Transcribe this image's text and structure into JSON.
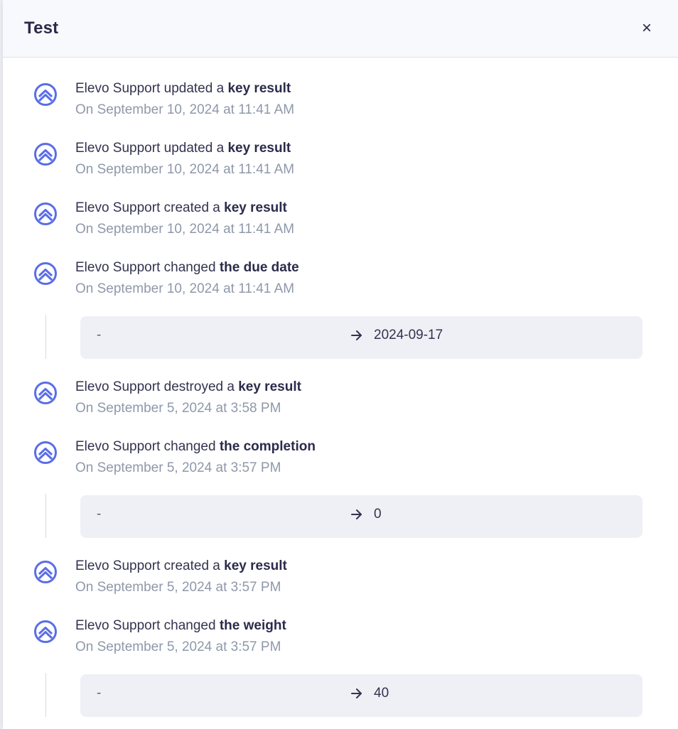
{
  "panel": {
    "title": "Test",
    "close_label": "×"
  },
  "entries": [
    {
      "actor": "Elevo Support",
      "action": " updated a ",
      "target": "key result",
      "timestamp": "On September 10, 2024 at 11:41 AM"
    },
    {
      "actor": "Elevo Support",
      "action": " updated a ",
      "target": "key result",
      "timestamp": "On September 10, 2024 at 11:41 AM"
    },
    {
      "actor": "Elevo Support",
      "action": " created a ",
      "target": "key result",
      "timestamp": "On September 10, 2024 at 11:41 AM"
    },
    {
      "actor": "Elevo Support",
      "action": " changed ",
      "target": "the due date",
      "timestamp": "On September 10, 2024 at 11:41 AM"
    },
    {
      "actor": "Elevo Support",
      "action": " destroyed a ",
      "target": "key result",
      "timestamp": "On September 5, 2024 at 3:58 PM"
    },
    {
      "actor": "Elevo Support",
      "action": " changed ",
      "target": "the completion",
      "timestamp": "On September 5, 2024 at 3:57 PM"
    },
    {
      "actor": "Elevo Support",
      "action": " created a ",
      "target": "key result",
      "timestamp": "On September 5, 2024 at 3:57 PM"
    },
    {
      "actor": "Elevo Support",
      "action": " changed ",
      "target": "the weight",
      "timestamp": "On September 5, 2024 at 3:57 PM"
    }
  ],
  "changes": [
    {
      "old": "-",
      "new": "2024-09-17"
    },
    {
      "old": "-",
      "new": "0"
    },
    {
      "old": "-",
      "new": "40"
    }
  ],
  "icons": {
    "entry_icon": "elevo-logo-icon",
    "close_icon": "close-icon",
    "arrow_icon": "arrow-right-icon"
  },
  "colors": {
    "brand": "#5a6ee6",
    "muted_text": "#8f98aa",
    "change_box": "#eff0f5"
  }
}
